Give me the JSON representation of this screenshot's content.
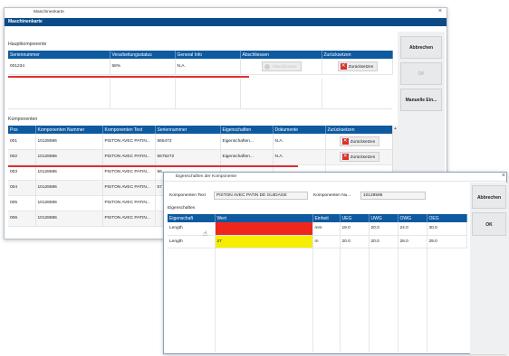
{
  "main": {
    "window_title": "Maschinenkarte",
    "header": "Maschinenkarte",
    "haupt_section": "Hauptkomponente",
    "haupt_columns": [
      "Seriennummer",
      "Verarbeitungsstatus",
      "General Info",
      "Abschliessen",
      "Zurücksetzen"
    ],
    "haupt_row": {
      "serial": "001234",
      "status": "68%",
      "info": "N.A.",
      "abschliessen": "Abschliessen",
      "zuruecksetzen": "Zurücksetzen"
    },
    "komp_section": "Komponenten",
    "komp_columns": [
      "Pos",
      "Komponenten Nummer",
      "Komponenten Text",
      "Seriennummer",
      "Eigenschaften",
      "Dokumente",
      "Zurücksetzen"
    ],
    "komp_rows": [
      {
        "pos": "001",
        "nummer": "10128596",
        "text": "PISTON AVEC PATIN...",
        "serial": "565472",
        "eig": "Eigenschaften...",
        "dok": "N.A.",
        "reset": "Zurücksetzen"
      },
      {
        "pos": "002",
        "nummer": "10128596",
        "text": "PISTON AVEC PATIN...",
        "serial": "5675272",
        "eig": "Eigenschaften...",
        "dok": "N.A.",
        "reset": "Zurücksetzen"
      },
      {
        "pos": "003",
        "nummer": "10128596",
        "text": "PISTON AVEC PATIN...",
        "serial": "56...",
        "eig": "",
        "dok": "",
        "reset": ""
      },
      {
        "pos": "004",
        "nummer": "10128596",
        "text": "PISTON AVEC PATIN...",
        "serial": "57",
        "eig": "",
        "dok": "",
        "reset": ""
      },
      {
        "pos": "005",
        "nummer": "10128596",
        "text": "PISTON AVEC PATIN...",
        "serial": "",
        "eig": "",
        "dok": "",
        "reset": ""
      },
      {
        "pos": "006",
        "nummer": "10128596",
        "text": "PISTON AVEC PATIN...",
        "serial": "",
        "eig": "",
        "dok": "",
        "reset": ""
      }
    ],
    "side_buttons": {
      "abbrechen": "Abbrechen",
      "ok": "OK",
      "manuelle": "Manuelle Ein..."
    }
  },
  "dialog": {
    "title": "Eigenschaften der Komponente",
    "komponenten_text_label": "Komponenten Text",
    "komponenten_text_value": "PISTON AVEC PATIN DE GUIDAGE",
    "komponenten_nummer_label": "Komponenten Nu...",
    "komponenten_nummer_value": "10128596",
    "eig_section": "Eigenschaften",
    "columns": [
      "Eigenschaft",
      "Wert",
      "Einheit",
      "UEG",
      "UWG",
      "OWG",
      "OEG"
    ],
    "rows": [
      {
        "eigenschaft": "Length",
        "wert": "",
        "einheit": "mm",
        "ueg": "19.0",
        "uwg": "20.0",
        "owg": "24.0",
        "oeg": "30.0",
        "color": "#f0261c"
      },
      {
        "eigenschaft": "Length",
        "wert": "27",
        "einheit": "m",
        "ueg": "20.0",
        "uwg": "20.0",
        "owg": "26.0",
        "oeg": "29.0",
        "color": "#f5ee00"
      }
    ],
    "buttons": {
      "abbrechen": "Abbrechen",
      "ok": "OK"
    }
  }
}
